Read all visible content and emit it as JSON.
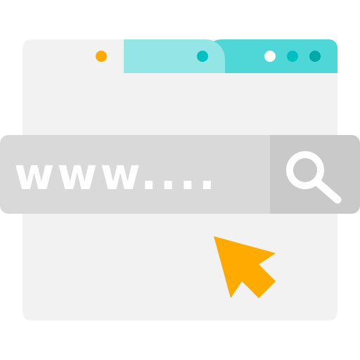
{
  "address_bar": {
    "url_text": "www...."
  },
  "icons": {
    "search": "search-icon",
    "cursor": "mouse-pointer-icon",
    "tab_dot": "dot-icon"
  },
  "colors": {
    "window_bg": "#f2f2f2",
    "tab_active": "#93e5e6",
    "tab_strip": "#4fd6d7",
    "address_bar_bg": "#d9d9d9",
    "search_button_bg": "#c9c9c9",
    "accent_orange": "#ffaa00",
    "dot_teal": "#00bfc1",
    "dot_white": "#ffffff"
  }
}
